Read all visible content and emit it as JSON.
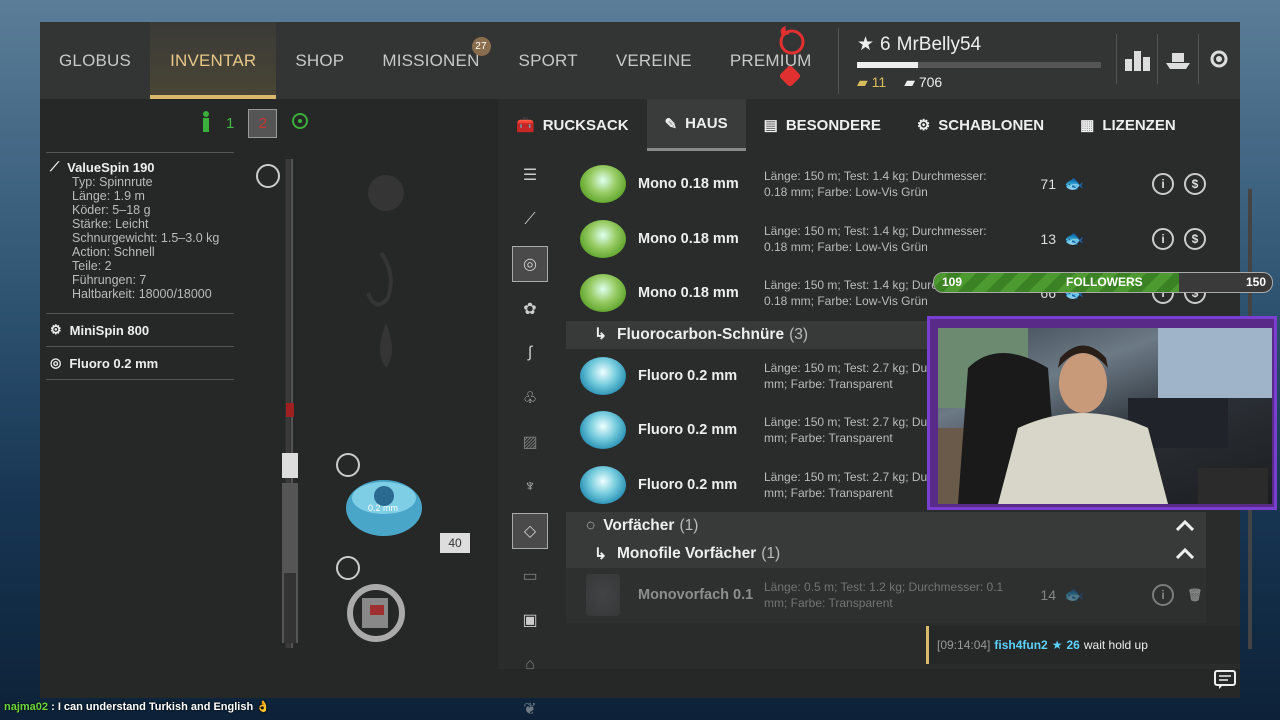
{
  "nav": {
    "items": [
      {
        "label": "GLOBUS"
      },
      {
        "label": "INVENTAR",
        "active": true
      },
      {
        "label": "SHOP"
      },
      {
        "label": "MISSIONEN",
        "badge": "27"
      },
      {
        "label": "SPORT"
      },
      {
        "label": "VEREINE"
      },
      {
        "label": "PREMIUM"
      }
    ]
  },
  "profile": {
    "level": "6",
    "name": "MrBelly54",
    "xp_fraction": 0.25,
    "gold": "11",
    "silver": "706"
  },
  "toolbar": {
    "count1": "1",
    "count2": "2"
  },
  "props": {
    "rod": {
      "title": "ValueSpin 190",
      "lines": [
        "Typ: Spinnrute",
        "Länge: 1.9 m",
        "Köder: 5–18 g",
        "Stärke: Leicht",
        "Schnurgewicht: 1.5–3.0 kg",
        "Action: Schnell",
        "Teile: 2",
        "Führungen: 7",
        "Haltbarkeit: 18000/18000"
      ]
    },
    "reel": {
      "title": "MiniSpin 800"
    },
    "line": {
      "title": "Fluoro 0.2 mm"
    }
  },
  "rod_area": {
    "spool_count": "40",
    "spool_label": "0.2 mm"
  },
  "tabs": [
    {
      "label": "RUCKSACK"
    },
    {
      "label": "HAUS",
      "active": true
    },
    {
      "label": "BESONDERE"
    },
    {
      "label": "SCHABLONEN"
    },
    {
      "label": "LIZENZEN"
    }
  ],
  "items": {
    "mono": [
      {
        "name": "Mono 0.18 mm",
        "desc": "Länge: 150 m; Test: 1.4 kg; Durchmesser: 0.18 mm; Farbe: Low-Vis Grün",
        "count": "71"
      },
      {
        "name": "Mono 0.18 mm",
        "desc": "Länge: 150 m; Test: 1.4 kg; Durchmesser: 0.18 mm; Farbe: Low-Vis Grün",
        "count": "13"
      },
      {
        "name": "Mono 0.18 mm",
        "desc": "Länge: 150 m; Test: 1.4 kg; Durchmesser: 0.18 mm; Farbe: Low-Vis Grün",
        "count": "66"
      }
    ],
    "fluoro_group": {
      "label": "Fluorocarbon-Schnüre",
      "count": "(3)"
    },
    "fluoro": [
      {
        "name": "Fluoro 0.2 mm",
        "desc": "Länge: 150 m; Test: 2.7 kg; Durchmesser: 0.2 mm; Farbe: Transparent"
      },
      {
        "name": "Fluoro 0.2 mm",
        "desc": "Länge: 150 m; Test: 2.7 kg; Durchmesser: 0.2 mm; Farbe: Transparent"
      },
      {
        "name": "Fluoro 0.2 mm",
        "desc": "Länge: 150 m; Test: 2.7 kg; Durchmesser: 0.2 mm; Farbe: Transparent"
      }
    ],
    "leader_group": {
      "label": "Vorfächer",
      "count": "(1)"
    },
    "mono_leader_group": {
      "label": "Monofile Vorfächer",
      "count": "(1)"
    },
    "leader": {
      "name": "Monovorfach 0.1",
      "desc": "Länge: 0.5 m; Test: 1.2 kg; Durchmesser: 0.1 mm; Farbe: Transparent",
      "count": "14"
    }
  },
  "followers": {
    "min": "109",
    "label": "FOLLOWERS",
    "max": "150",
    "fraction": 0.726
  },
  "chat": {
    "time": "[09:14:04]",
    "user": "fish4fun2",
    "num": "26",
    "msg": "wait hold up"
  },
  "bottom_chat": {
    "user": "najma02",
    "msg": ": I can understand Turkish and English"
  }
}
